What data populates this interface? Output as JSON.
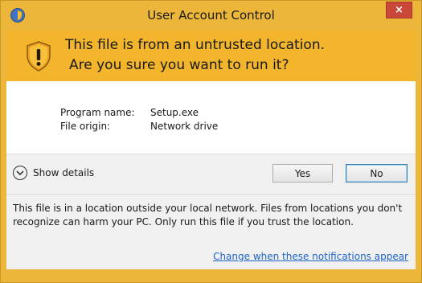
{
  "window": {
    "title": "User Account Control",
    "close_label": "×",
    "accent_color": "#f2b52c",
    "titlebar_color": "#ebb63a",
    "close_color": "#c9483a"
  },
  "header": {
    "line1": "This file is from an untrusted location.",
    "line2": "Are you sure you want to run it?"
  },
  "info": {
    "program_label": "Program name:",
    "program_value": "Setup.exe",
    "origin_label": "File origin:",
    "origin_value": "Network drive"
  },
  "actions": {
    "show_details": "Show details",
    "yes_label": "Yes",
    "no_label": "No"
  },
  "footer": {
    "warning": "This file is in a location outside your local network. Files from locations you don't recognize can harm your PC. Only run this file if you trust the location.",
    "link": "Change when these notifications appear"
  },
  "icons": {
    "title": "uac-shield-icon",
    "header": "warning-shield-icon",
    "toggle": "chevron-down-icon",
    "close": "close-icon"
  }
}
